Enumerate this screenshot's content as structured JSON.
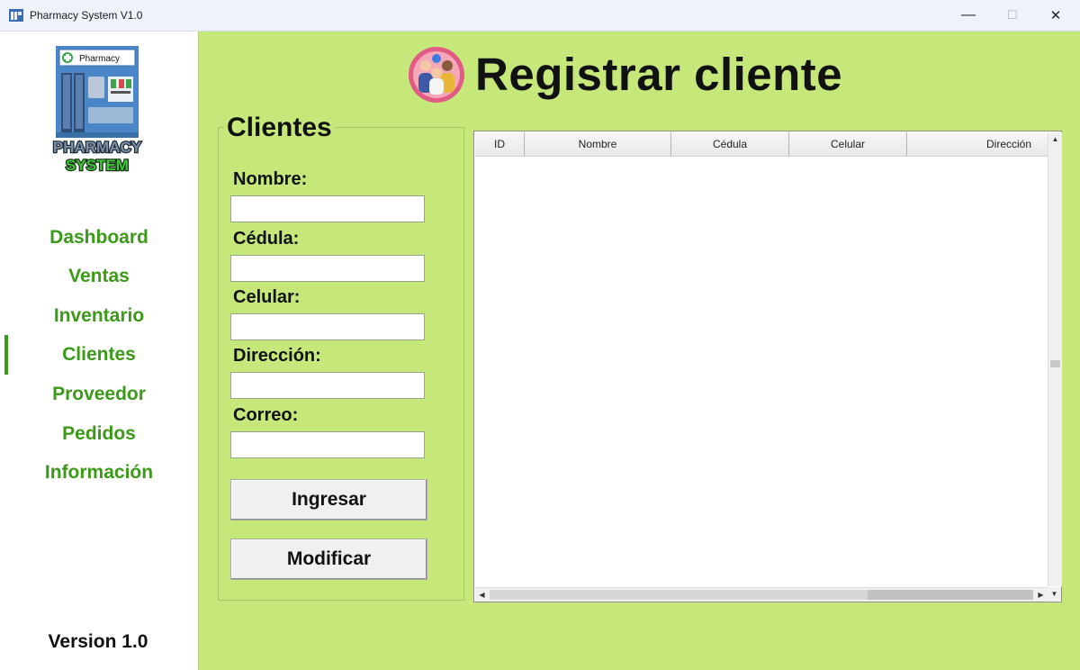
{
  "window": {
    "title": "Pharmacy System V1.0",
    "minimize_glyph": "—",
    "maximize_glyph": "☐",
    "close_glyph": "✕"
  },
  "logo": {
    "sign_text": "Pharmacy",
    "line1": "PHARMACY",
    "line2": "SYSTEM"
  },
  "sidebar": {
    "items": [
      {
        "label": "Dashboard"
      },
      {
        "label": "Ventas"
      },
      {
        "label": "Inventario"
      },
      {
        "label": "Clientes",
        "active": true
      },
      {
        "label": "Proveedor"
      },
      {
        "label": "Pedidos"
      },
      {
        "label": "Información"
      }
    ],
    "version": "Version 1.0"
  },
  "header": {
    "title": "Registrar cliente",
    "icon": "people-group-icon"
  },
  "form": {
    "group_title": "Clientes",
    "fields": [
      {
        "label": "Nombre:",
        "value": ""
      },
      {
        "label": "Cédula:",
        "value": ""
      },
      {
        "label": "Celular:",
        "value": ""
      },
      {
        "label": "Dirección:",
        "value": ""
      },
      {
        "label": "Correo:",
        "value": ""
      }
    ],
    "buttons": {
      "submit": "Ingresar",
      "modify": "Modificar"
    }
  },
  "table": {
    "columns": [
      "ID",
      "Nombre",
      "Cédula",
      "Celular",
      "Dirección"
    ],
    "rows": []
  },
  "colors": {
    "main_bg": "#c6e87b",
    "nav_text": "#3b9a17",
    "sidebar_bg": "#ffffff"
  }
}
